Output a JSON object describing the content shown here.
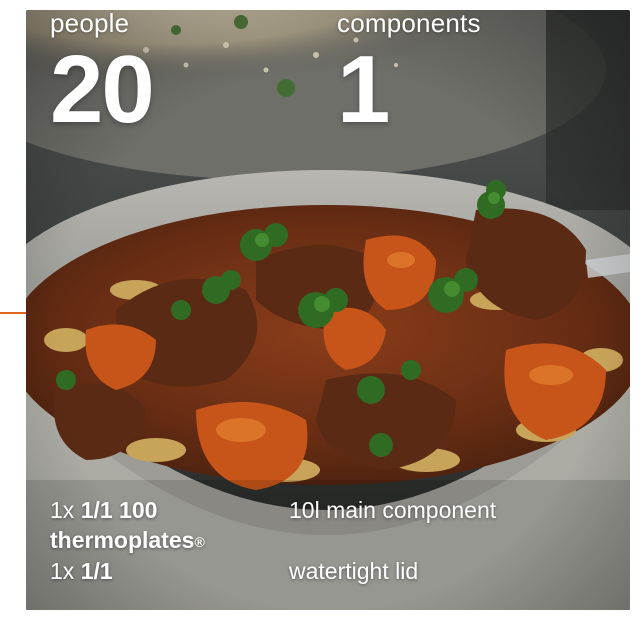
{
  "stats": {
    "people_label": "people",
    "people_value": "20",
    "components_label": "components",
    "components_value": "1"
  },
  "specs": [
    {
      "qty": "1x",
      "size": "1/1 100",
      "product": "thermoplates",
      "mark": "®",
      "description": "10l main component"
    },
    {
      "qty": "1x",
      "size": "1/1",
      "description": "watertight lid"
    }
  ],
  "colors": {
    "accent": "#e2671e",
    "text": "#ffffff"
  }
}
